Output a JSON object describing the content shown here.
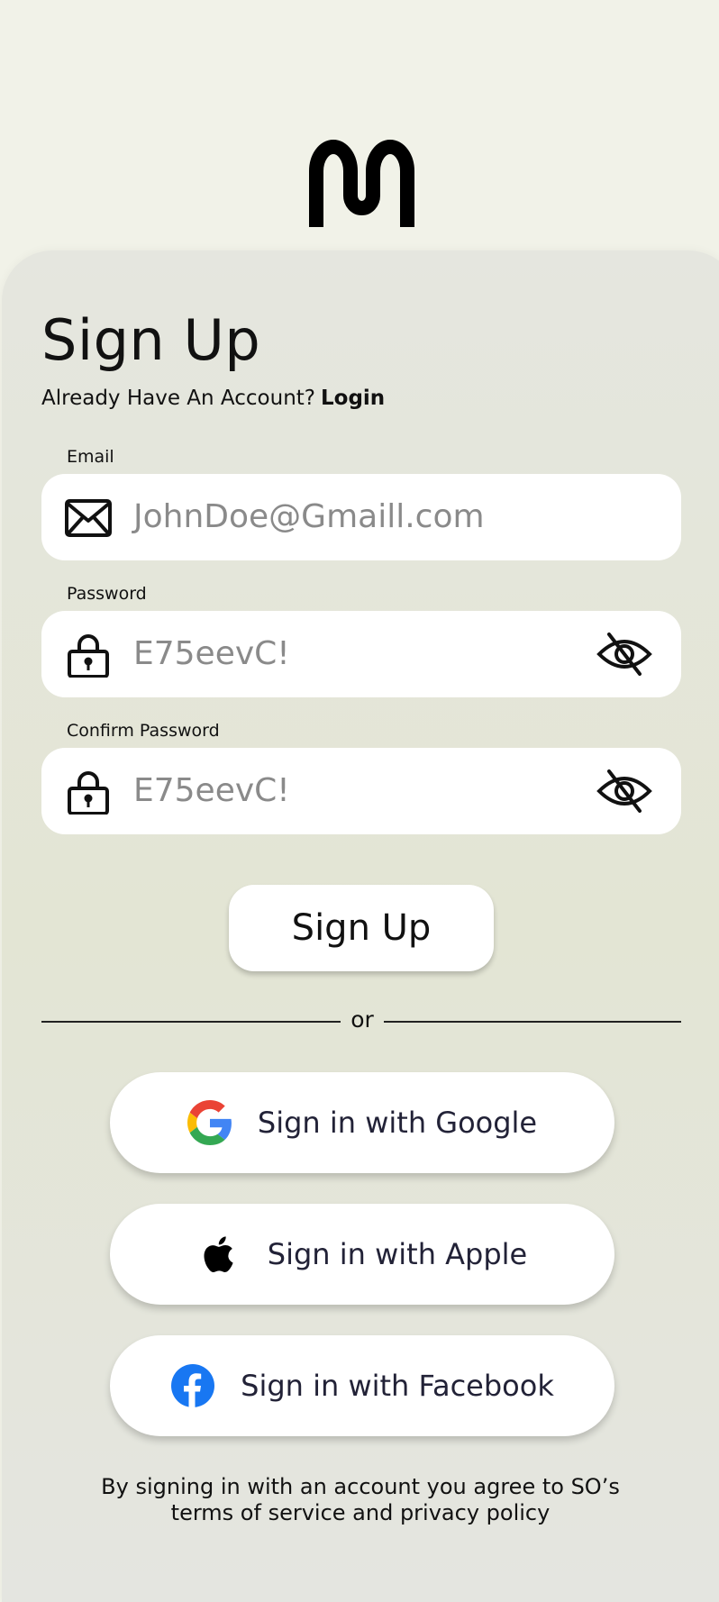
{
  "header": {
    "logo_icon": "m-logo-icon"
  },
  "page": {
    "title": "Sign Up",
    "login_prompt": "Already Have An Account?",
    "login_link": "Login"
  },
  "form": {
    "email": {
      "label": "Email",
      "value": "JohnDoe@Gmaill.com",
      "icon": "envelope-icon"
    },
    "password": {
      "label": "Password",
      "value": "E75eevC!",
      "icon": "lock-icon",
      "toggle_icon": "eye-slash-icon"
    },
    "confirm_password": {
      "label": "Confirm Password",
      "value": "E75eevC!",
      "icon": "lock-icon",
      "toggle_icon": "eye-slash-icon"
    },
    "submit_label": "Sign Up"
  },
  "divider": {
    "text": "or"
  },
  "social": [
    {
      "label": "Sign in with Google",
      "icon": "google-icon"
    },
    {
      "label": "Sign in with Apple",
      "icon": "apple-icon"
    },
    {
      "label": "Sign in with Facebook",
      "icon": "facebook-icon"
    }
  ],
  "footer": {
    "line1": "By signing in with an account you agree to SO’s",
    "line2": "terms of service and privacy policy"
  },
  "colors": {
    "background": "#f1f2e8",
    "card": "#e4e5da",
    "field": "#ffffff",
    "placeholder_text": "#8a8a8a",
    "facebook_blue": "#1877f2"
  }
}
